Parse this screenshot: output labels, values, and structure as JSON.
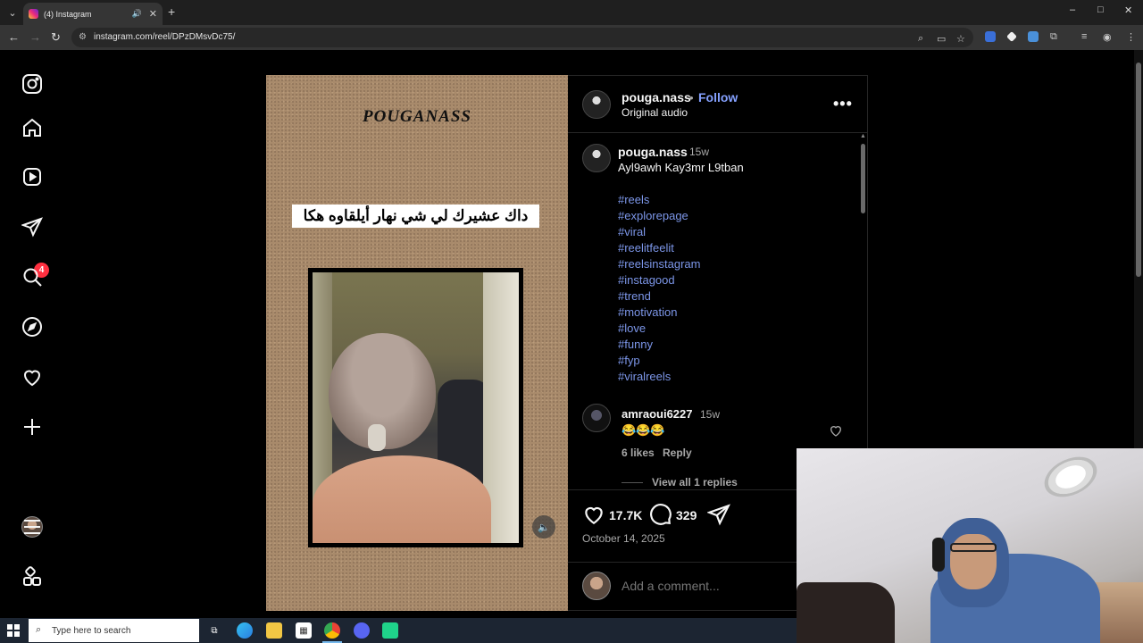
{
  "browser": {
    "tab_title": "(4) Instagram",
    "url": "instagram.com/reel/DPzDMsvDc75/",
    "new_tab": "+",
    "win_min": "–",
    "win_max": "□",
    "win_close": "✕"
  },
  "nav": {
    "notifications_count": "4"
  },
  "reel": {
    "brand": "POUGANASS",
    "caption": "داك عشيرك لي شي نهار أيلقاوه هكا"
  },
  "post": {
    "username": "pouga.nass",
    "separator": "•",
    "follow_label": "Follow",
    "audio": "Original audio",
    "more": "•••"
  },
  "caption": {
    "username": "pouga.nass",
    "time": "15w",
    "text": "Ayl9awh Kay3mr L9tban",
    "hashtags": [
      "#reels",
      "#explorepage",
      "#viral",
      "#reelitfeelit",
      "#reelsinstagram",
      "#instagood",
      "#trend",
      "#motivation",
      "#love",
      "#funny",
      "#fyp",
      "#viralreels"
    ]
  },
  "comment": {
    "username": "amraoui6227",
    "time": "15w",
    "text": "😂😂😂",
    "likes": "6 likes",
    "reply_label": "Reply",
    "view_replies": "View all 1 replies"
  },
  "actions": {
    "likes": "17.7K",
    "comments": "329",
    "date": "October 14, 2025"
  },
  "add_comment": {
    "placeholder": "Add a comment..."
  },
  "taskbar": {
    "search_placeholder": "Type here to search"
  }
}
